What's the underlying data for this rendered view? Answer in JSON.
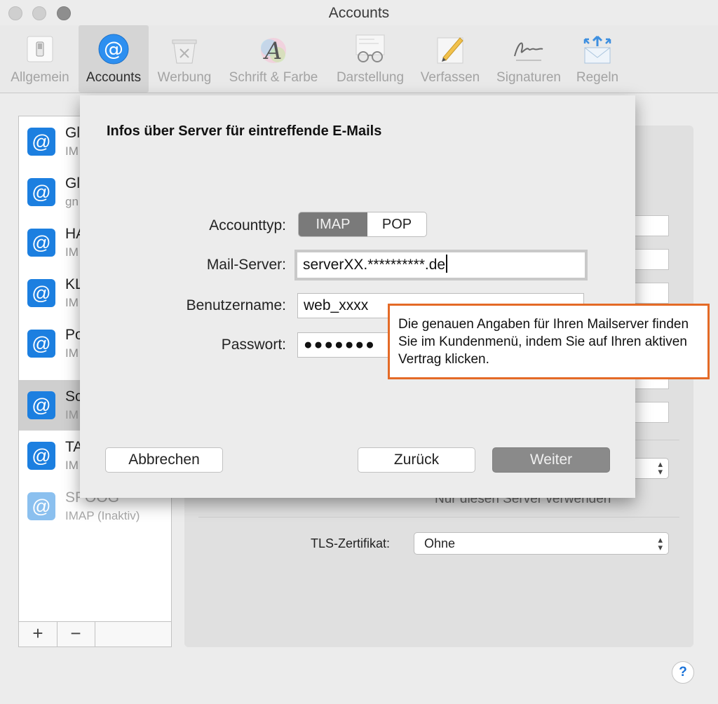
{
  "window": {
    "title": "Accounts"
  },
  "toolbar": {
    "items": [
      {
        "label": "Allgemein"
      },
      {
        "label": "Accounts"
      },
      {
        "label": "Werbung"
      },
      {
        "label": "Schrift & Farbe"
      },
      {
        "label": "Darstellung"
      },
      {
        "label": "Verfassen"
      },
      {
        "label": "Signaturen"
      },
      {
        "label": "Regeln"
      }
    ],
    "selected": "Accounts"
  },
  "accounts": [
    {
      "name": "Gl",
      "sub": "IM"
    },
    {
      "name": "Gl",
      "sub": "gn"
    },
    {
      "name": "HA",
      "sub": "IM"
    },
    {
      "name": "KL",
      "sub": "IM"
    },
    {
      "name": "Po",
      "sub": "IM"
    },
    {
      "name": "Sc",
      "sub": "IM"
    },
    {
      "name": "TA",
      "sub": "IM"
    },
    {
      "name": "SPOOG",
      "sub": "IMAP (Inaktiv)"
    }
  ],
  "account_icon_glyph": "@",
  "list_buttons": {
    "add": "+",
    "remove": "−"
  },
  "background_panel": {
    "partial_text": "Nur diesen Server verwenden",
    "tls_label": "TLS-Zertifikat:",
    "tls_value": "Ohne"
  },
  "sheet": {
    "title": "Infos über Server für eintreffende E-Mails",
    "account_type_label": "Accounttyp:",
    "account_type_options": [
      "IMAP",
      "POP"
    ],
    "account_type_selected": "IMAP",
    "mail_server_label": "Mail-Server:",
    "mail_server_value": "serverXX.**********.de",
    "username_label": "Benutzername:",
    "username_value": "web_xxxx",
    "password_label": "Passwort:",
    "password_value": "●●●●●●●",
    "buttons": {
      "cancel": "Abbrechen",
      "back": "Zurück",
      "next": "Weiter"
    }
  },
  "callout": {
    "text": "Die genauen Angaben für Ihren Mailserver finden Sie im Kundenmenü, indem Sie auf Ihren aktiven Vertrag klicken."
  },
  "help": {
    "glyph": "?"
  },
  "colors": {
    "account_icon_blue": "#1c7fe0",
    "callout_border": "#e46a26",
    "selected_segment": "#7a7a7a",
    "primary_button": "#8a8a8a"
  }
}
